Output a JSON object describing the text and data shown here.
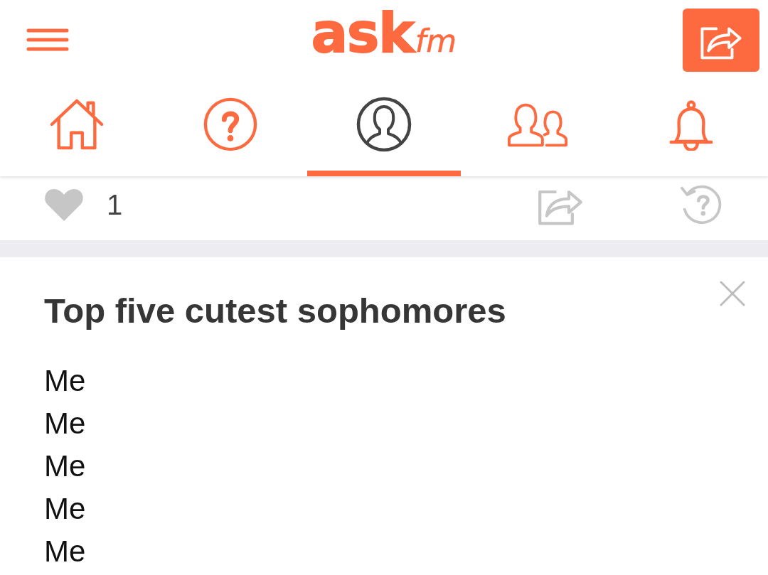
{
  "header": {
    "logo": {
      "main": "ask",
      "suffix": "fm"
    }
  },
  "tabs": [
    {
      "kind": "home",
      "selected": false
    },
    {
      "kind": "questions",
      "selected": false
    },
    {
      "kind": "profile",
      "selected": true
    },
    {
      "kind": "friends",
      "selected": false
    },
    {
      "kind": "notifications",
      "selected": false
    }
  ],
  "answer_actions": {
    "liked": false,
    "likes": "1"
  },
  "question": {
    "title": "Top five cutest sophomores",
    "answer_lines": [
      "Me",
      "Me",
      "Me",
      "Me",
      "Me"
    ]
  }
}
